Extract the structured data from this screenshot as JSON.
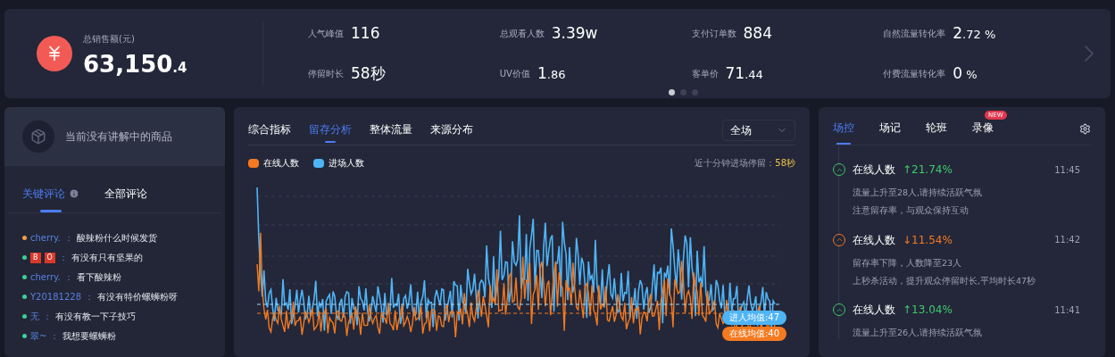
{
  "summary": {
    "sales": {
      "label": "总销售额(元)",
      "value": "63,150",
      "fraction": ".4"
    },
    "metrics": [
      {
        "label": "人气峰值",
        "value": "116"
      },
      {
        "label": "总观看人数",
        "value": "3.39w"
      },
      {
        "label": "支付订单数",
        "value": "884"
      },
      {
        "label": "自然流量转化率",
        "value": "2",
        "fraction": ".72 %"
      },
      {
        "label": "停留时长",
        "value": "58秒"
      },
      {
        "label": "UV价值",
        "value": "1",
        "fraction": ".86"
      },
      {
        "label": "客单价",
        "value": "71",
        "fraction": ".44"
      },
      {
        "label": "付费流量转化率",
        "value": "0",
        "fraction": " %"
      }
    ],
    "pages": [
      {
        "selected": true
      },
      {
        "selected": false
      },
      {
        "selected": false
      }
    ]
  },
  "product": {
    "text": "当前没有讲解中的商品"
  },
  "comment_tabs": [
    {
      "label": "关键评论",
      "selected": true,
      "info": true
    },
    {
      "label": "全部评论",
      "selected": false,
      "info": false
    }
  ],
  "comments": [
    {
      "kind": "name",
      "user": "cherry.",
      "separator": "：",
      "text": "酸辣粉什么时候发货",
      "color": "#f0a04b"
    },
    {
      "kind": "badges",
      "badges": [
        "B",
        "O"
      ],
      "separator": "：",
      "text": "有没有只有坚果的",
      "color": "#3ecf9a"
    },
    {
      "kind": "name",
      "user": "cherry.",
      "separator": "：",
      "text": "看下酸辣粉",
      "color": "#3ecf9a"
    },
    {
      "kind": "name",
      "user": "Y20181228",
      "separator": "：",
      "text": "有没有特价螺蛳粉呀",
      "color": "#3ecf9a"
    },
    {
      "kind": "name",
      "user": "无",
      "separator": "：",
      "text": "有没有教一下子技巧",
      "color": "#3ecf9a"
    },
    {
      "kind": "name",
      "user": "翠~",
      "separator": "：",
      "text": "我想要螺蛳粉",
      "color": "#3ecf9a"
    }
  ],
  "analysis": {
    "tabs": [
      {
        "label": "综合指标",
        "selected": false
      },
      {
        "label": "留存分析",
        "selected": true
      },
      {
        "label": "整体流量",
        "selected": false
      },
      {
        "label": "来源分布",
        "selected": false
      }
    ],
    "scope": {
      "value": "全场"
    },
    "legend": [
      {
        "label": "在线人数",
        "color": "#f47a20"
      },
      {
        "label": "进场人数",
        "color": "#4fb4f5"
      }
    ],
    "note": {
      "label": "近十分钟进场停留：",
      "value": "58秒"
    },
    "averages": [
      {
        "label": "进人均值:47",
        "color": "#4fb4f5"
      },
      {
        "label": "在线均值:40",
        "color": "#f47a20"
      }
    ]
  },
  "control": {
    "tabs": [
      {
        "label": "场控",
        "selected": true
      },
      {
        "label": "场记",
        "selected": false
      },
      {
        "label": "轮班",
        "selected": false
      },
      {
        "label": "录像",
        "selected": false,
        "badge": "NEW"
      }
    ],
    "events": [
      {
        "title": "在线人数",
        "kind": "up",
        "change": "↑21.74%",
        "time": "11:45",
        "notes": [
          "流量上升至28人,请持续活跃气氛",
          "注意留存率，与观众保持互动"
        ]
      },
      {
        "title": "在线人数",
        "kind": "down",
        "change": "↓11.54%",
        "time": "11:42",
        "notes": [
          "留存率下降，人数降至23人",
          "上秒杀活动，提升观众停留时长,平均时长47秒"
        ]
      },
      {
        "title": "在线人数",
        "kind": "up",
        "change": "↑13.04%",
        "time": "11:41",
        "notes": [
          "流量上升至26人,请持续活跃气氛"
        ]
      }
    ]
  }
}
